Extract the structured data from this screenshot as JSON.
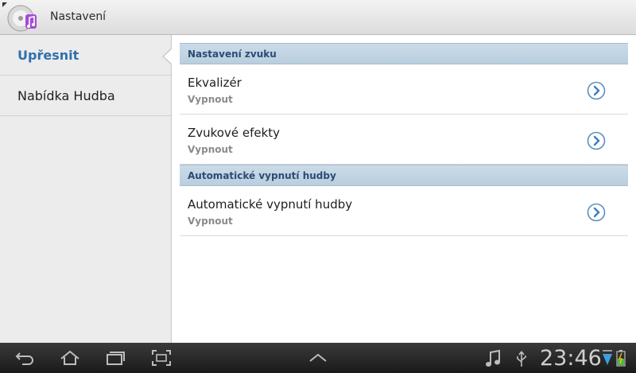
{
  "app": {
    "title": "Nastavení"
  },
  "sidebar": {
    "items": [
      {
        "label": "Upřesnit",
        "active": true
      },
      {
        "label": "Nabídka Hudba",
        "active": false
      }
    ]
  },
  "sections": [
    {
      "header": "Nastavení zvuku",
      "rows": [
        {
          "title": "Ekvalizér",
          "value": "Vypnout"
        },
        {
          "title": "Zvukové efekty",
          "value": "Vypnout"
        }
      ]
    },
    {
      "header": "Automatické vypnutí hudby",
      "rows": [
        {
          "title": "Automatické vypnutí hudby",
          "value": "Vypnout"
        }
      ]
    }
  ],
  "statusbar": {
    "time": "23:46"
  },
  "colors": {
    "accent": "#2f6fae",
    "section_bg": "#c3d5e4",
    "section_text": "#2a4c74"
  }
}
